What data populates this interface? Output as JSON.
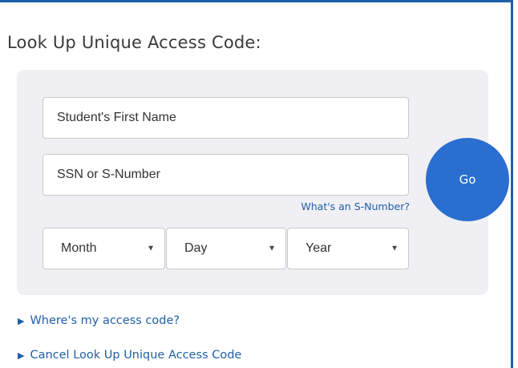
{
  "title": "Look Up Unique Access Code:",
  "form": {
    "first_name_placeholder": "Student's First Name",
    "ssn_placeholder": "SSN or S-Number",
    "help_link": "What's an S-Number?",
    "go_label": "Go",
    "month": {
      "selected": "Month"
    },
    "day": {
      "selected": "Day"
    },
    "year": {
      "selected": "Year"
    }
  },
  "links": {
    "where": "Where's my access code?",
    "cancel": "Cancel Look Up Unique Access Code"
  },
  "icons": {
    "dropdown_arrow": "triangle-down-icon",
    "expand_arrow": "triangle-right-icon"
  },
  "colors": {
    "accent": "#1f5fa8",
    "go_button": "#2a6fcf",
    "form_bg": "#efeff4"
  }
}
